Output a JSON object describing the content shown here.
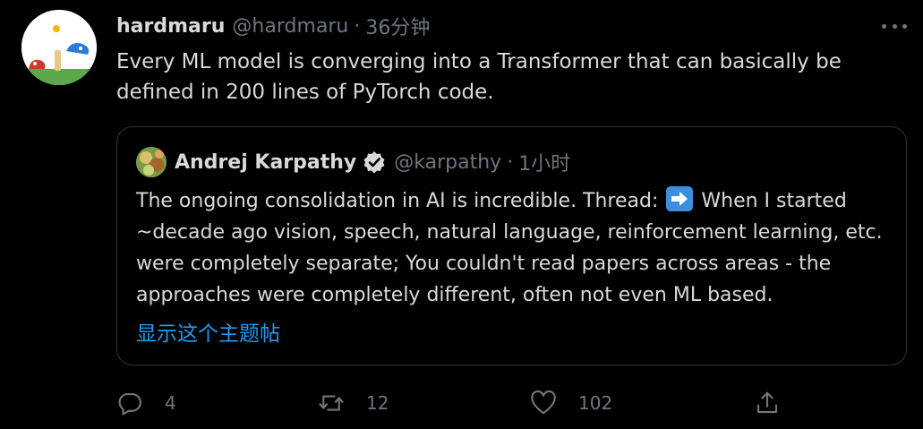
{
  "tweet": {
    "author_name": "hardmaru",
    "handle": "@hardmaru",
    "separator": "·",
    "time": "36分钟",
    "text": "Every ML model is converging into a Transformer that can basically be defined in 200 lines of PyTorch code."
  },
  "quoted_tweet": {
    "author_name": "Andrej Karpathy",
    "verified": true,
    "handle": "@karpathy",
    "separator": "·",
    "time": "1小时",
    "text_before_emoji": "The ongoing consolidation in AI is incredible. Thread:",
    "emoji": "right-arrow-emoji",
    "text_after_emoji": "When I started ~decade ago vision, speech, natural language, reinforcement learning, etc. were completely separate; You couldn't read papers across areas - the approaches were completely different, often not even ML based.",
    "show_thread_label": "显示这个主题帖"
  },
  "actions": {
    "reply_count": "4",
    "retweet_count": "12",
    "like_count": "102",
    "icons": [
      "reply-icon",
      "retweet-icon",
      "like-icon",
      "share-icon"
    ]
  },
  "colors": {
    "background": "#000000",
    "text": "#d9d9d9",
    "secondary": "#6e767d",
    "link": "#1d9bf0",
    "border": "#2f3336"
  }
}
